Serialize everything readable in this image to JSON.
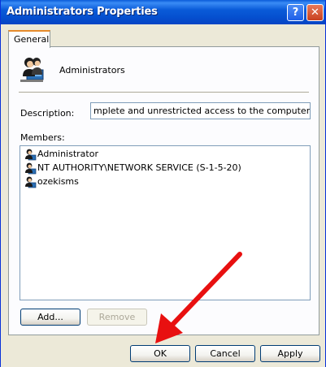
{
  "window": {
    "title": "Administrators Properties",
    "help_glyph": "?",
    "close_glyph": "✕"
  },
  "tabs": [
    {
      "label": "General",
      "selected": true
    }
  ],
  "group": {
    "icon": "group-users-icon",
    "name": "Administrators"
  },
  "description": {
    "label": "Description:",
    "value": "mplete and unrestricted access to the computer/domain"
  },
  "members": {
    "label": "Members:",
    "items": [
      {
        "name": "Administrator",
        "icon": "user-icon"
      },
      {
        "name": "NT AUTHORITY\\NETWORK SERVICE (S-1-5-20)",
        "icon": "user-icon"
      },
      {
        "name": "ozekisms",
        "icon": "user-icon"
      }
    ]
  },
  "buttons": {
    "add": "Add...",
    "remove": "Remove",
    "ok": "OK",
    "cancel": "Cancel",
    "apply": "Apply"
  },
  "colors": {
    "titlebar": "#0a5bd9",
    "arrow": "#e81010",
    "tab_accent": "#e68b2c"
  }
}
